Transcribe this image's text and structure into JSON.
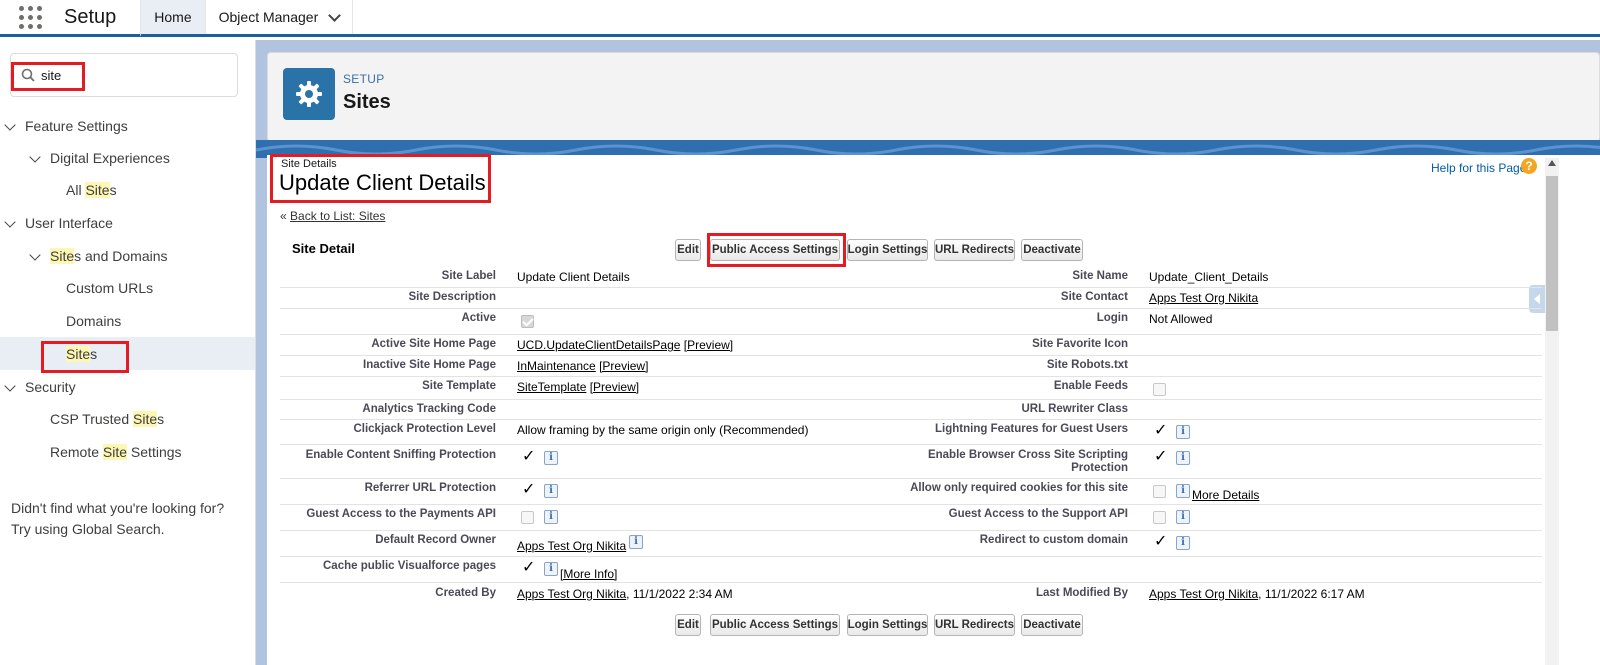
{
  "topbar": {
    "app_name": "Setup",
    "tabs": [
      {
        "label": "Home"
      },
      {
        "label": "Object Manager"
      }
    ]
  },
  "sidebar": {
    "search_value": "site",
    "tree": {
      "feature_settings": "Feature Settings",
      "digital_experiences": "Digital Experiences",
      "all_sites_pre": "All ",
      "all_sites_hl": "Site",
      "all_sites_post": "s",
      "user_interface": "User Interface",
      "sites_domains_hl": "Site",
      "sites_domains_post": "s and Domains",
      "custom_urls": "Custom URLs",
      "domains": "Domains",
      "sites_hl": "Site",
      "sites_post": "s",
      "security": "Security",
      "csp_pre": "CSP Trusted ",
      "csp_hl": "Site",
      "csp_post": "s",
      "remote_pre": "Remote ",
      "remote_hl": "Site",
      "remote_post": " Settings"
    },
    "help_line1": "Didn't find what you're looking for?",
    "help_line2": "Try using Global Search."
  },
  "header": {
    "eyebrow": "SETUP",
    "title": "Sites"
  },
  "detail": {
    "eyebrow": "Site Details",
    "title": "Update Client Details",
    "back_prefix": "« ",
    "back_link": "Back to List: Sites",
    "help_link": "Help for this Page",
    "section_title": "Site Detail",
    "buttons": {
      "edit": "Edit",
      "public_access": "Public Access Settings",
      "login_settings": "Login Settings",
      "url_redirects": "URL Redirects",
      "deactivate": "Deactivate"
    },
    "labels": {
      "site_label": "Site Label",
      "site_description": "Site Description",
      "active": "Active",
      "active_home": "Active Site Home Page",
      "inactive_home": "Inactive Site Home Page",
      "site_template": "Site Template",
      "analytics": "Analytics Tracking Code",
      "clickjack": "Clickjack Protection Level",
      "content_sniffing": "Enable Content Sniffing Protection",
      "referrer": "Referrer URL Protection",
      "guest_payments": "Guest Access to the Payments API",
      "default_owner": "Default Record Owner",
      "cache_vf": "Cache public Visualforce pages",
      "created_by": "Created By",
      "site_name": "Site Name",
      "site_contact": "Site Contact",
      "login": "Login",
      "favicon": "Site Favorite Icon",
      "robots": "Site Robots.txt",
      "enable_feeds": "Enable Feeds",
      "url_rewriter": "URL Rewriter Class",
      "lightning_guest": "Lightning Features for Guest Users",
      "xss_line1": "Enable Browser Cross Site Scripting",
      "xss_line2": "Protection",
      "required_cookies": "Allow only required cookies for this site",
      "guest_support": "Guest Access to the Support API",
      "redirect_custom": "Redirect to custom domain",
      "last_modified": "Last Modified By"
    },
    "values": {
      "site_label": "Update Client Details",
      "active_home_link": "UCD.UpdateClientDetailsPage",
      "inactive_home_link": "InMaintenance",
      "template_link": "SiteTemplate",
      "preview": "[Preview]",
      "clickjack": "Allow framing by the same origin only (Recommended)",
      "default_owner": "Apps Test Org Nikita",
      "more_info": "[More Info]",
      "created_by_user": "Apps Test Org Nikita",
      "created_by_date": ", 11/1/2022 2:34 AM",
      "site_name": "Update_Client_Details",
      "site_contact": "Apps Test Org Nikita",
      "login": "Not Allowed",
      "more_details": "More Details",
      "modified_by_user": "Apps Test Org Nikita",
      "modified_by_date": ", 11/1/2022 6:17 AM"
    },
    "tick": "✓",
    "info": "i"
  },
  "colors": {
    "brand_blue": "#1b5f9e",
    "highlight_red": "#e31b23",
    "search_highlight": "#fcf7b3",
    "page_bg": "#b0c4df"
  }
}
